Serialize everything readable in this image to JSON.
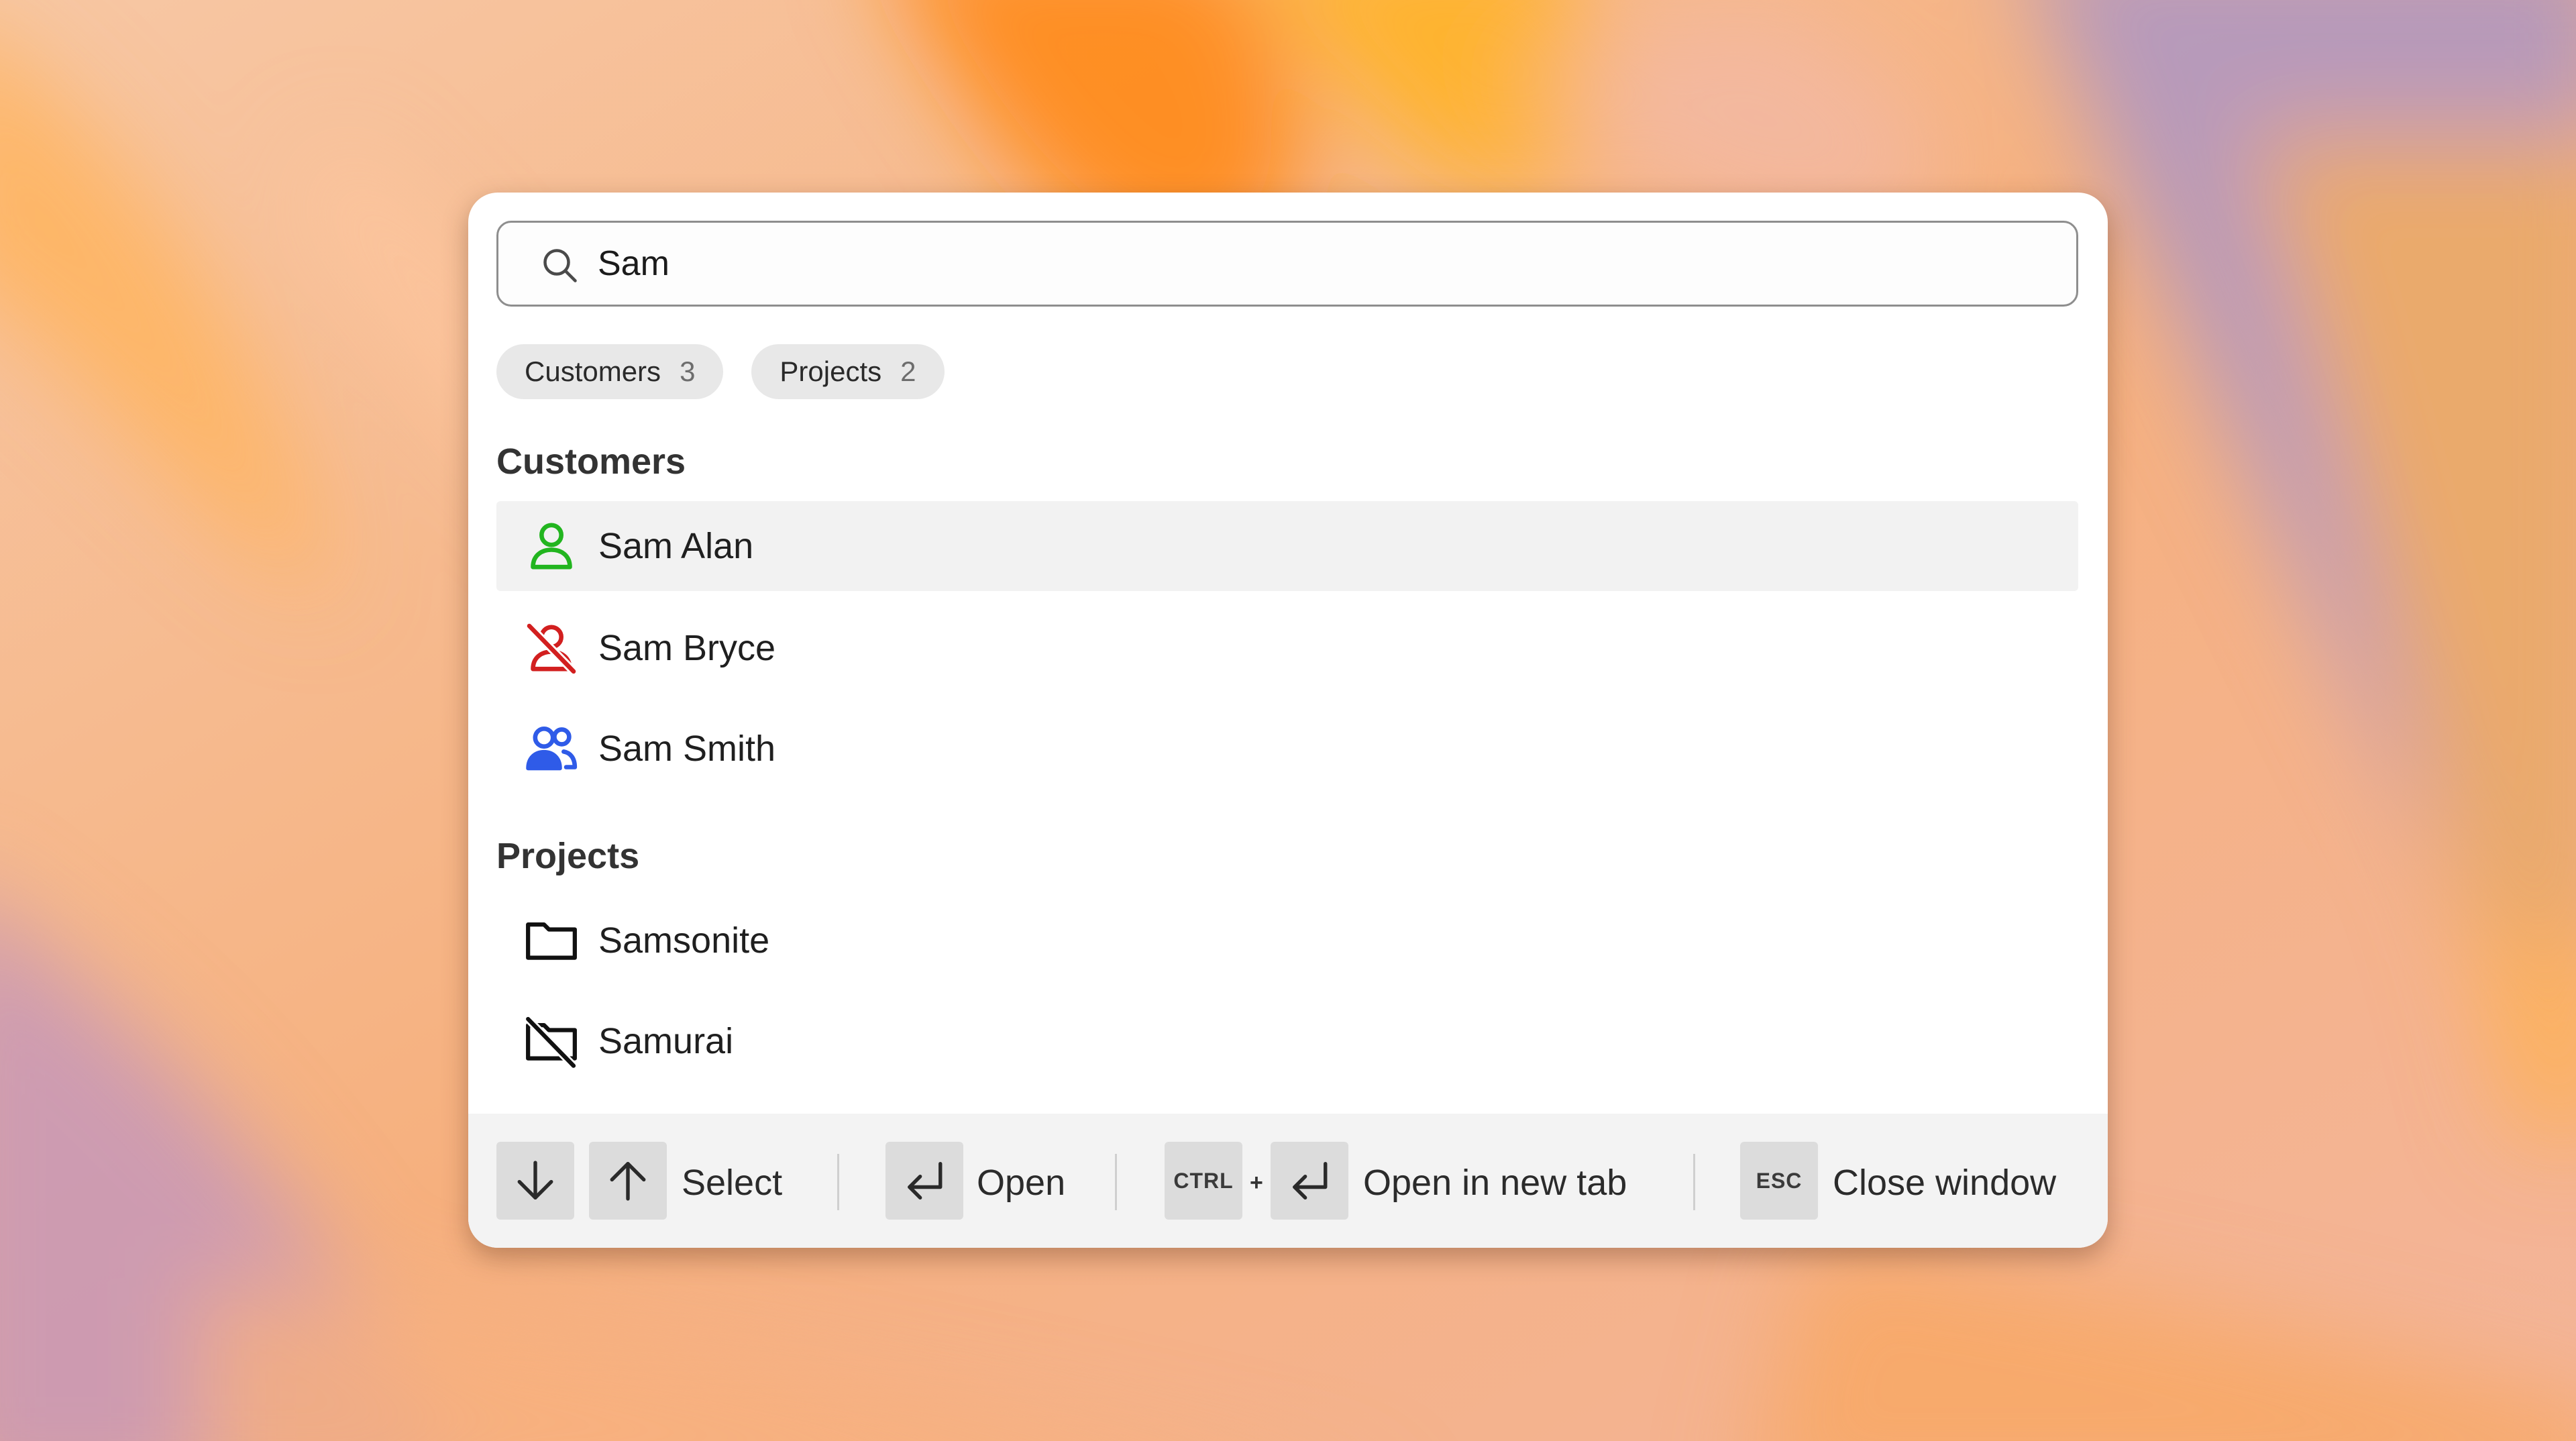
{
  "search": {
    "value": "Sam",
    "placeholder": ""
  },
  "filters": [
    {
      "label": "Customers",
      "count": "3"
    },
    {
      "label": "Projects",
      "count": "2"
    }
  ],
  "customers": {
    "title": "Customers",
    "items": [
      {
        "name": "Sam Alan",
        "icon": "user-icon",
        "color": "#22b51f",
        "selected": true
      },
      {
        "name": "Sam Bryce",
        "icon": "user-off-icon",
        "color": "#d21f1f",
        "selected": false
      },
      {
        "name": "Sam Smith",
        "icon": "users-icon",
        "color": "#2f5be8",
        "selected": false
      }
    ]
  },
  "projects": {
    "title": "Projects",
    "items": [
      {
        "name": "Samsonite",
        "icon": "folder-icon"
      },
      {
        "name": "Samurai",
        "icon": "folder-off-icon"
      }
    ]
  },
  "footer": {
    "select_label": "Select",
    "open_label": "Open",
    "ctrl_key": "CTRL",
    "plus": "+",
    "open_new_tab_label": "Open in new tab",
    "esc_key": "ESC",
    "close_label": "Close window"
  }
}
